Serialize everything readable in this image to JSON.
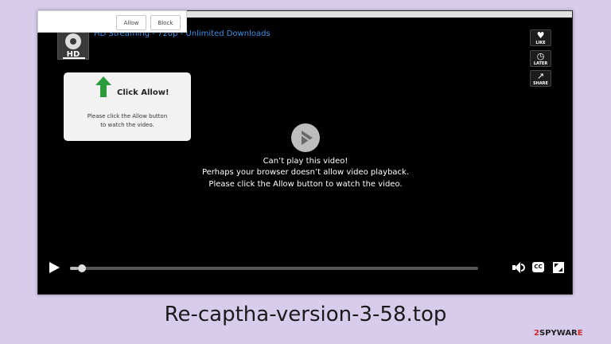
{
  "notification": {
    "allow_label": "Allow",
    "block_label": "Block"
  },
  "player": {
    "logo_text": "HD",
    "site_title": "HD Streaming - 720p - Unlimited Downloads",
    "side_buttons": [
      {
        "label": "LIKE",
        "icon": "heart-icon",
        "glyph": "♥"
      },
      {
        "label": "LATER",
        "icon": "clock-icon",
        "glyph": "◷"
      },
      {
        "label": "SHARE",
        "icon": "share-icon",
        "glyph": "↗"
      }
    ],
    "allow_card": {
      "heading": "Click Allow!",
      "body_line1": "Please click the Allow button",
      "body_line2": "to watch the video."
    },
    "message": {
      "line1": "Can’t play this video!",
      "line2": "Perhaps your browser doesn’t allow video playback.",
      "line3": "Please click the Allow button to watch the video."
    },
    "progress_fraction": 0.02,
    "cc_label": "CC"
  },
  "caption": "Re-captha-version-3-58.top",
  "watermark": {
    "prefix": "2",
    "main": "SPYWAR",
    "suffix": "E"
  },
  "colors": {
    "background": "#d8ccec",
    "player_bg": "#000000",
    "title_link": "#3d8fe3",
    "arrow_green": "#2a9a3a",
    "watermark_accent": "#d32828"
  }
}
